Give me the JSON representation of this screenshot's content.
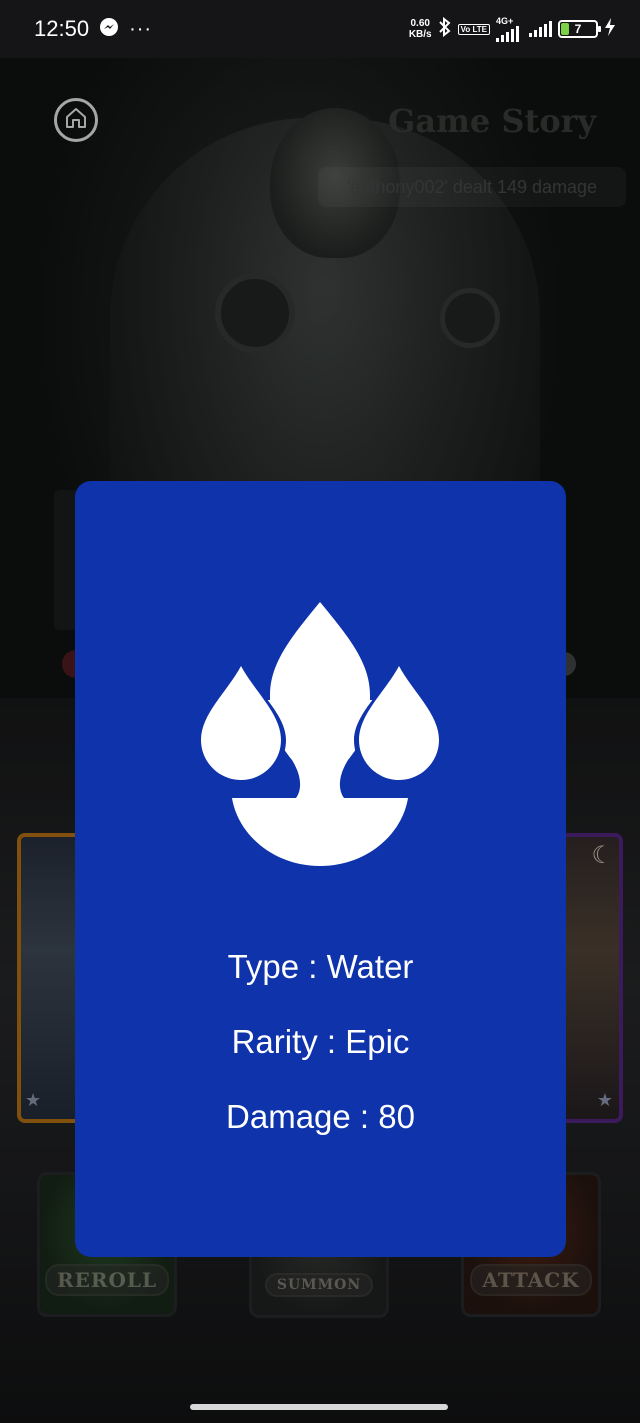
{
  "status_bar": {
    "time": "12:50",
    "net_speed_value": "0.60",
    "net_speed_unit": "KB/s",
    "network_label": "4G+",
    "volte_label": "Vo LTE",
    "battery_level": "7"
  },
  "header": {
    "title": "Game Story",
    "latest_log": "'anthony002' dealt 149 damage"
  },
  "actions": {
    "reroll_label": "REROLL",
    "summon_label": "SUMMON",
    "attack_label": "ATTACK"
  },
  "card_detail": {
    "element_icon": "water-drops-icon",
    "type": "Type : Water",
    "rarity": "Rarity : Epic",
    "damage": "Damage : 80",
    "background_color": "#0e33ab"
  }
}
